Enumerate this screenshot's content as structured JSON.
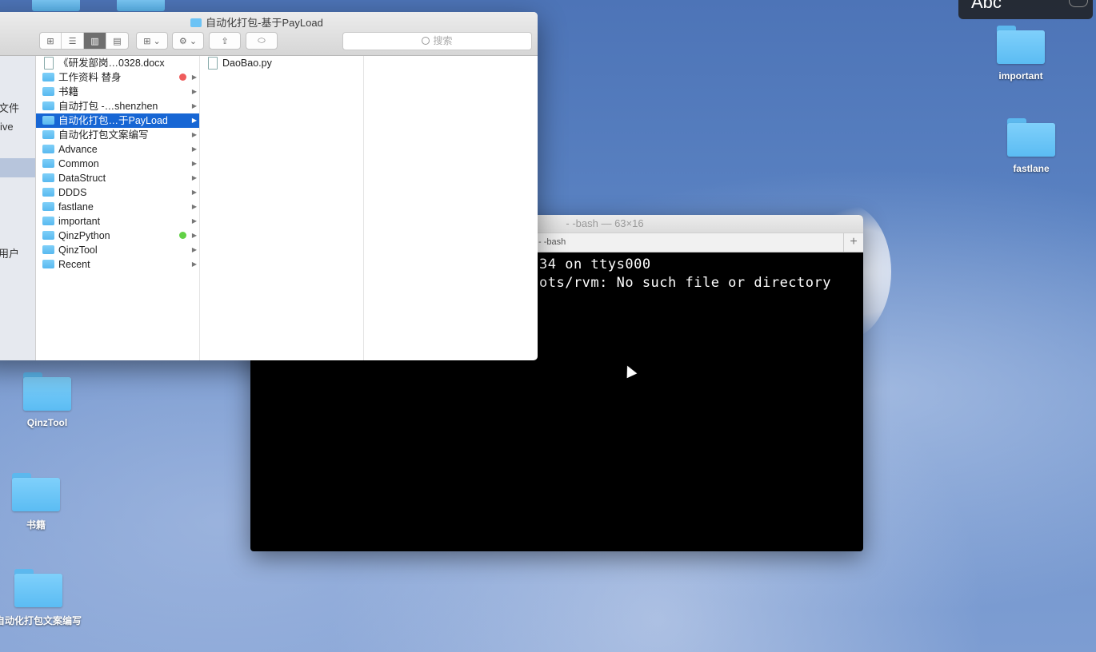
{
  "desktop": {
    "icons": [
      {
        "label": "important"
      },
      {
        "label": "fastlane"
      },
      {
        "label": "QinzTool"
      },
      {
        "label": "书籍"
      },
      {
        "label": "自动化打包文案编写"
      }
    ]
  },
  "input_source": {
    "label": "Abc"
  },
  "terminal": {
    "title": "- -bash — 63×16",
    "tab_label": "- -bash",
    "new_tab_label": "+",
    "lines": [
      "34 on ttys000",
      "ots/rvm: No such file or directory"
    ]
  },
  "finder": {
    "title": "自动化打包-基于PayLoad",
    "search_placeholder": "搜索",
    "sidebar": {
      "items": [
        {
          "label": "文件"
        },
        {
          "label": "ive"
        },
        {
          "label": "用户"
        }
      ]
    },
    "column1": [
      {
        "label": "《研发部岗…0328.docx",
        "type": "doc",
        "has_children": false
      },
      {
        "label": "工作资料 替身",
        "type": "folder",
        "tag_color": "#ef5c5c",
        "has_children": true
      },
      {
        "label": "书籍",
        "type": "folder",
        "has_children": true
      },
      {
        "label": "自动打包 -…shenzhen",
        "type": "folder",
        "has_children": true
      },
      {
        "label": "自动化打包…于PayLoad",
        "type": "folder",
        "has_children": true,
        "selected": true
      },
      {
        "label": "自动化打包文案编写",
        "type": "folder",
        "has_children": true
      },
      {
        "label": "Advance",
        "type": "folder",
        "has_children": true
      },
      {
        "label": "Common",
        "type": "folder",
        "has_children": true
      },
      {
        "label": "DataStruct",
        "type": "folder",
        "has_children": true
      },
      {
        "label": "DDDS",
        "type": "folder",
        "has_children": true
      },
      {
        "label": "fastlane",
        "type": "folder",
        "has_children": true
      },
      {
        "label": "important",
        "type": "folder",
        "has_children": true
      },
      {
        "label": "QinzPython",
        "type": "folder",
        "tag_color": "#62d146",
        "has_children": true
      },
      {
        "label": "QinzTool",
        "type": "folder",
        "has_children": true
      },
      {
        "label": "Recent",
        "type": "folder",
        "has_children": true
      }
    ],
    "column2": [
      {
        "label": "DaoBao.py",
        "type": "doc"
      }
    ]
  },
  "colors": {
    "selection": "#1766d4",
    "folder": "#6cc3f5",
    "terminal_bg": "#000000"
  }
}
